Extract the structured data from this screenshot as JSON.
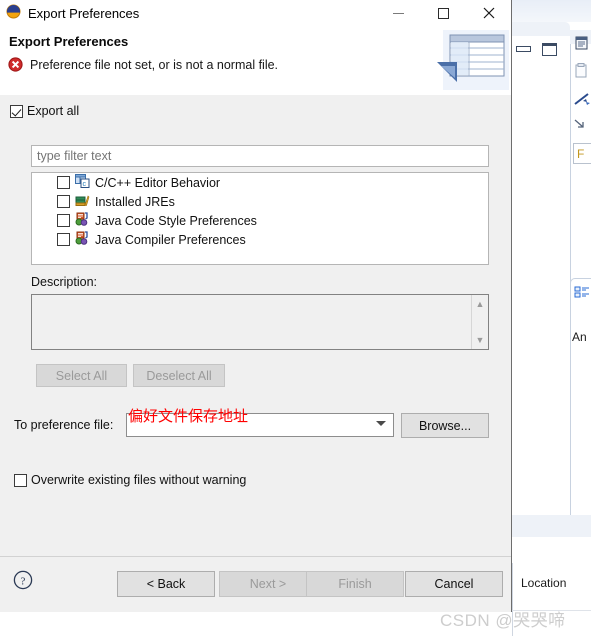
{
  "window": {
    "title": "Export Preferences",
    "icon": "eclipse-globe-icon",
    "minimize_label": "Minimize",
    "maximize_label": "Maximize",
    "close_label": "Close"
  },
  "banner": {
    "heading": "Export Preferences",
    "message": "Preference file not set, or is not a normal file.",
    "status_icon": "error-icon",
    "image_icon": "export-table-icon"
  },
  "form": {
    "export_all": {
      "label": "Export all",
      "checked": true
    },
    "filter": {
      "value": "",
      "placeholder": "type filter text"
    },
    "tree_items": [
      {
        "label": "C/C++ Editor Behavior",
        "icon": "cpp-editor-icon",
        "checked": false
      },
      {
        "label": "Installed JREs",
        "icon": "jre-icon",
        "checked": false
      },
      {
        "label": "Java Code Style Preferences",
        "icon": "java-prefs-icon",
        "checked": false
      },
      {
        "label": "Java Compiler Preferences",
        "icon": "java-prefs-icon",
        "checked": false
      }
    ],
    "description_label": "Description:",
    "description_value": "",
    "select_all_label": "Select All",
    "deselect_all_label": "Deselect All",
    "pref_file_label": "To preference file:",
    "pref_file_value": "",
    "browse_label": "Browse...",
    "annotation": "偏好文件保存地址",
    "annotation_color": "#ff0000",
    "overwrite": {
      "label": "Overwrite existing files without warning",
      "checked": false
    }
  },
  "buttonbar": {
    "help_icon": "help-icon",
    "back_label": "< Back",
    "next_label": "Next >",
    "finish_label": "Finish",
    "cancel_label": "Cancel"
  },
  "background": {
    "right_view_text": "F",
    "outline_label": "An",
    "location_label": "Location",
    "icons": {
      "restore": "restore-icon",
      "maximize": "maximize-icon",
      "doc": "document-icon",
      "clip": "clipboard-icon",
      "wand": "wand-icon",
      "arrow": "arrow-icon",
      "outline": "outline-icon"
    }
  },
  "watermark": "CSDN @哭哭啼"
}
